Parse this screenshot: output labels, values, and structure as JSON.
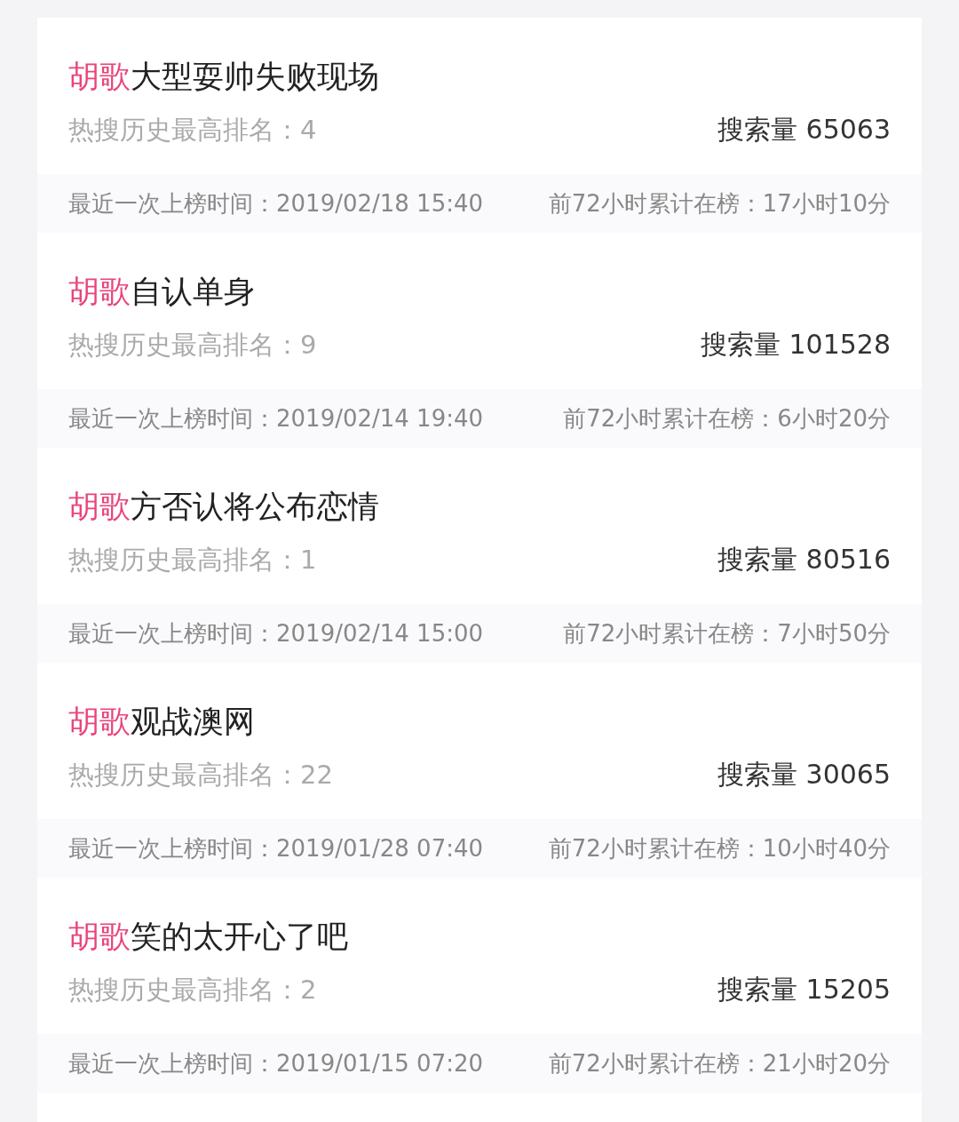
{
  "items": [
    {
      "keyword": "胡歌",
      "title": "大型耍帅失败现场",
      "peak_rank": "热搜历史最高排名：4",
      "search_volume": "搜索量 65063",
      "last_listed": "最近一次上榜时间：2019/02/18 15:40",
      "hours_72": "前72小时累计在榜：17小时10分"
    },
    {
      "keyword": "胡歌",
      "title": "自认单身",
      "peak_rank": "热搜历史最高排名：9",
      "search_volume": "搜索量 101528",
      "last_listed": "最近一次上榜时间：2019/02/14 19:40",
      "hours_72": "前72小时累计在榜：6小时20分"
    },
    {
      "keyword": "胡歌",
      "title": "方否认将公布恋情",
      "peak_rank": "热搜历史最高排名：1",
      "search_volume": "搜索量 80516",
      "last_listed": "最近一次上榜时间：2019/02/14 15:00",
      "hours_72": "前72小时累计在榜：7小时50分"
    },
    {
      "keyword": "胡歌",
      "title": "观战澳网",
      "peak_rank": "热搜历史最高排名：22",
      "search_volume": "搜索量 30065",
      "last_listed": "最近一次上榜时间：2019/01/28 07:40",
      "hours_72": "前72小时累计在榜：10小时40分"
    },
    {
      "keyword": "胡歌",
      "title": "笑的太开心了吧",
      "peak_rank": "热搜历史最高排名：2",
      "search_volume": "搜索量 15205",
      "last_listed": "最近一次上榜时间：2019/01/15 07:20",
      "hours_72": "前72小时累计在榜：21小时20分"
    }
  ]
}
